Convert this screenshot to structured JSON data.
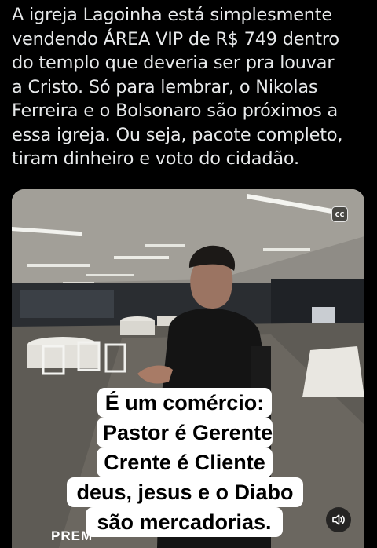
{
  "post": {
    "text_lines": [
      "A igreja Lagoinha está simplesmente",
      "vendendo ÁREA VIP de R$ 749 dentro",
      "do templo que deveria ser pra louvar",
      "a Cristo. Só para lembrar, o Nikolas",
      "Ferreira e o Bolsonaro são próximos a",
      "essa igreja. Ou seja, pacote completo,",
      "tiram dinheiro e voto do cidadão."
    ]
  },
  "video": {
    "cc_label": "CC",
    "caption_lines": [
      "É um comércio:",
      "Pastor é Gerente",
      "Crente é Cliente",
      "deus, jesus e  o Diabo",
      "são mercadorias."
    ],
    "bottom_overlay_text": "PREM",
    "volume_icon": "speaker-sound-icon"
  },
  "colors": {
    "background": "#000000",
    "text": "#e7e9ea",
    "caption_bg": "#ffffff",
    "caption_text": "#000000"
  }
}
